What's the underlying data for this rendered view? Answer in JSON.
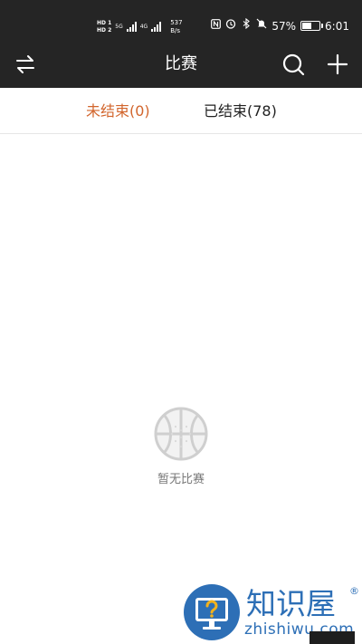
{
  "status_bar": {
    "hd1": "HD 1",
    "hd2": "HD 2",
    "gen1": "5G",
    "gen2": "4G",
    "speed_value": "537",
    "speed_unit": "B/s",
    "battery_percent": "57%",
    "battery_level": 0.57,
    "time": "6:01",
    "icons": [
      "nfc-icon",
      "alarm-icon",
      "bluetooth-icon",
      "mute-icon",
      "battery-icon"
    ]
  },
  "nav": {
    "title": "比赛",
    "left_icon": "switch-arrows-icon",
    "right_icons": [
      "search-icon",
      "plus-icon"
    ]
  },
  "tabs": [
    {
      "label": "未结束(0)",
      "active": true
    },
    {
      "label": "已结束(78)",
      "active": false
    }
  ],
  "empty_state": {
    "icon": "basketball-icon",
    "text": "暂无比赛"
  },
  "watermark": {
    "name": "知识屋",
    "registered": "®",
    "url": "zhishiwu.com",
    "icon": "monitor-question-icon"
  },
  "colors": {
    "bar_background": "#252525",
    "accent": "#d2652c",
    "watermark_blue": "#2d6fb6"
  }
}
